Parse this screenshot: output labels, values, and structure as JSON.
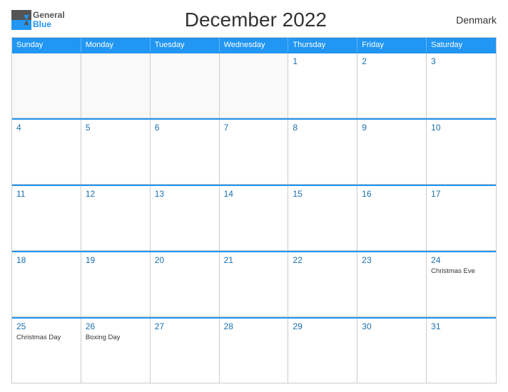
{
  "header": {
    "logo_general": "General",
    "logo_blue": "Blue",
    "title": "December 2022",
    "country": "Denmark"
  },
  "days": {
    "headers": [
      "Sunday",
      "Monday",
      "Tuesday",
      "Wednesday",
      "Thursday",
      "Friday",
      "Saturday"
    ]
  },
  "weeks": [
    {
      "cells": [
        {
          "number": "",
          "event": "",
          "empty": true
        },
        {
          "number": "",
          "event": "",
          "empty": true
        },
        {
          "number": "",
          "event": "",
          "empty": true
        },
        {
          "number": "",
          "event": "",
          "empty": true
        },
        {
          "number": "1",
          "event": ""
        },
        {
          "number": "2",
          "event": ""
        },
        {
          "number": "3",
          "event": ""
        }
      ]
    },
    {
      "cells": [
        {
          "number": "4",
          "event": ""
        },
        {
          "number": "5",
          "event": ""
        },
        {
          "number": "6",
          "event": ""
        },
        {
          "number": "7",
          "event": ""
        },
        {
          "number": "8",
          "event": ""
        },
        {
          "number": "9",
          "event": ""
        },
        {
          "number": "10",
          "event": ""
        }
      ]
    },
    {
      "cells": [
        {
          "number": "11",
          "event": ""
        },
        {
          "number": "12",
          "event": ""
        },
        {
          "number": "13",
          "event": ""
        },
        {
          "number": "14",
          "event": ""
        },
        {
          "number": "15",
          "event": ""
        },
        {
          "number": "16",
          "event": ""
        },
        {
          "number": "17",
          "event": ""
        }
      ]
    },
    {
      "cells": [
        {
          "number": "18",
          "event": ""
        },
        {
          "number": "19",
          "event": ""
        },
        {
          "number": "20",
          "event": ""
        },
        {
          "number": "21",
          "event": ""
        },
        {
          "number": "22",
          "event": ""
        },
        {
          "number": "23",
          "event": ""
        },
        {
          "number": "24",
          "event": "Christmas Eve"
        }
      ]
    },
    {
      "cells": [
        {
          "number": "25",
          "event": "Christmas Day"
        },
        {
          "number": "26",
          "event": "Boxing Day"
        },
        {
          "number": "27",
          "event": ""
        },
        {
          "number": "28",
          "event": ""
        },
        {
          "number": "29",
          "event": ""
        },
        {
          "number": "30",
          "event": ""
        },
        {
          "number": "31",
          "event": ""
        }
      ]
    }
  ]
}
